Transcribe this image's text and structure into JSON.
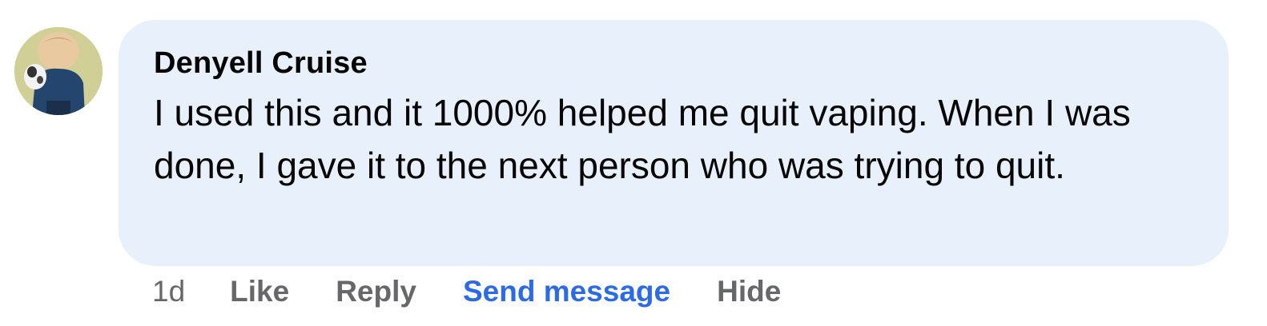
{
  "comment": {
    "author": "Denyell Cruise",
    "text": "I used this and it 1000% helped me quit vaping. When I was done, I gave it to the next person who was trying to quit.",
    "timestamp": "1d",
    "avatar_icon": "profile-photo-avatar",
    "bubble_color": "#e7f0fb"
  },
  "actions": {
    "like": "Like",
    "reply": "Reply",
    "send_message": "Send message",
    "hide": "Hide",
    "accent_color": "#2d6be4"
  }
}
